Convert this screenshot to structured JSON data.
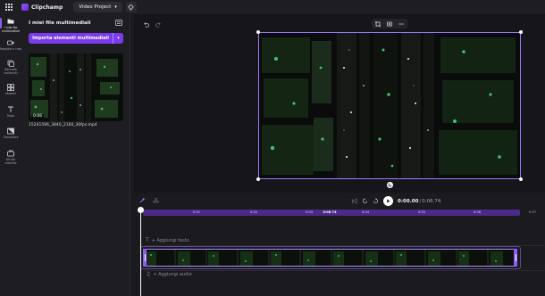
{
  "topbar": {
    "app_name": "Clipchamp",
    "project_name": "Video Project",
    "icons": [
      "apps-grid-icon",
      "clipchamp-logo-icon",
      "chevron-down-icon",
      "premium-gem-icon"
    ]
  },
  "rail": {
    "items": [
      {
        "label": "I miei file multimediali",
        "icon": "folder-icon",
        "active": true
      },
      {
        "label": "Registra e crea",
        "icon": "camera-icon"
      },
      {
        "label": "Raccolta contenuti",
        "icon": "library-icon"
      },
      {
        "label": "Modelli",
        "icon": "templates-icon"
      },
      {
        "label": "Testo",
        "icon": "text-icon"
      },
      {
        "label": "Transizioni",
        "icon": "transitions-icon"
      },
      {
        "label": "Kit del marchio",
        "icon": "brand-kit-icon"
      }
    ]
  },
  "media": {
    "title": "I miei file multimediali",
    "import_label": "Importa elementi multimediali",
    "items": [
      {
        "name": "15241596_3840_2160_30fps.mp4",
        "duration": "0:06"
      }
    ]
  },
  "preview": {
    "toolbar_icons": [
      "crop-icon",
      "fit-icon",
      "more-icon"
    ]
  },
  "playback": {
    "current_time": "0:00.00",
    "separator": " / ",
    "total_time": "0:06.74"
  },
  "timeline": {
    "ticks": [
      "0:01",
      "0:02",
      "0:03",
      "0:04",
      "0:05",
      "0:06"
    ],
    "end_marker": "0:06.74",
    "end_tick": "0:07",
    "add_text": "+ Aggiungi testo",
    "add_audio": "+ Aggiungi audio"
  },
  "colors": {
    "accent": "#7c3aed",
    "selection": "#a78bfa",
    "background": "#1a1a1f"
  }
}
